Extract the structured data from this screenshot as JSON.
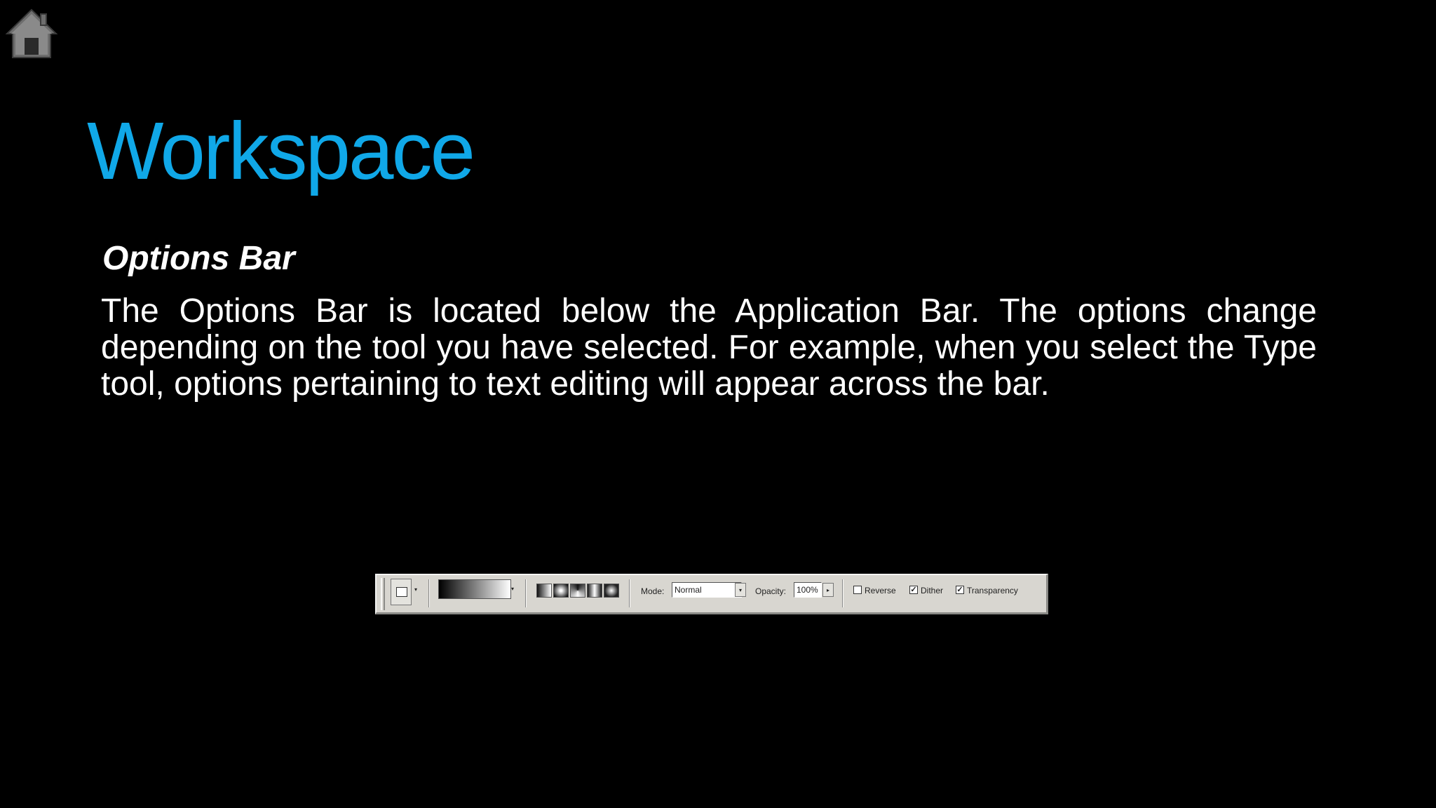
{
  "nav": {
    "home_icon": "home-icon"
  },
  "slide": {
    "title": "Workspace",
    "section_heading": "Options Bar",
    "body": "The Options Bar is located below the Application Bar. The options change depending on the tool you have selected. For example, when you select the Type tool, options pertaining to text editing will appear across the bar."
  },
  "options_bar": {
    "mode_label": "Mode:",
    "mode_value": "Normal",
    "opacity_label": "Opacity:",
    "opacity_value": "100%",
    "checkboxes": [
      {
        "label": "Reverse",
        "checked": false
      },
      {
        "label": "Dither",
        "checked": true
      },
      {
        "label": "Transparency",
        "checked": true
      }
    ],
    "check_mark": "✓",
    "dropdown_glyph": "▾",
    "stepper_glyph": "▸"
  },
  "colors": {
    "background": "#000000",
    "title": "#10a8e8",
    "text": "#ffffff",
    "bar": "#d8d6d0"
  }
}
